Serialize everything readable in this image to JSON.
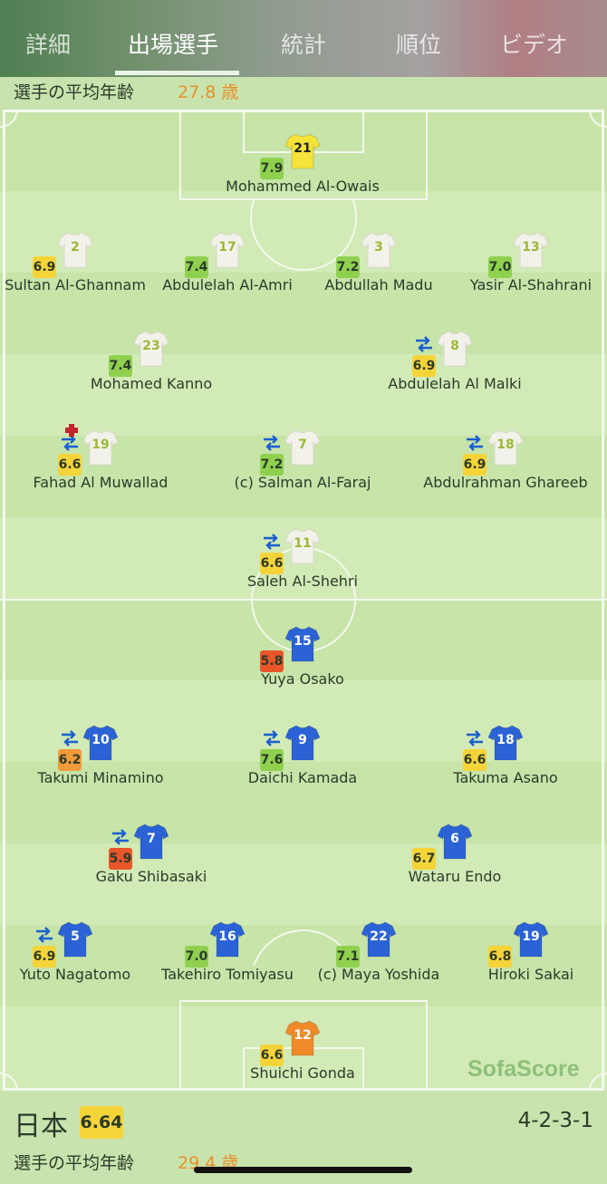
{
  "tabs": [
    "詳細",
    "出場選手",
    "統計",
    "順位",
    "ビデオ"
  ],
  "active_tab": "出場選手",
  "top_team": {
    "avg_age_label": "選手の平均年齢",
    "avg_age_value": "27.8 歳"
  },
  "bottom_team": {
    "name": "日本",
    "rating": "6.64",
    "formation": "4-2-3-1",
    "avg_age_label": "選手の平均年齢",
    "avg_age_value": "29.4 歳"
  },
  "watermark": "SofaScore",
  "colors": {
    "rating_high": "#8fd14f",
    "rating_mid": "#f5d43a",
    "rating_low": "#f09a3a",
    "rating_bad": "#e8562a",
    "home_kit": "#f2f2ea",
    "away_kit": "#2b63d6",
    "keeper_home": "#f5e23a",
    "keeper_away": "#f08a28"
  },
  "players": [
    {
      "name": "Mohammed Al-Owais",
      "number": "21",
      "rating": "7.9",
      "rating_level": "high",
      "kit": "keeper_home",
      "sub": false,
      "card": false
    },
    {
      "name": "Sultan Al-Ghannam",
      "number": "2",
      "rating": "6.9",
      "rating_level": "mid",
      "kit": "home",
      "sub": false,
      "card": false
    },
    {
      "name": "Abdulelah Al-Amri",
      "number": "17",
      "rating": "7.4",
      "rating_level": "high",
      "kit": "home",
      "sub": false,
      "card": false
    },
    {
      "name": "Abdullah Madu",
      "number": "3",
      "rating": "7.2",
      "rating_level": "high",
      "kit": "home",
      "sub": false,
      "card": false
    },
    {
      "name": "Yasir Al-Shahrani",
      "number": "13",
      "rating": "7.0",
      "rating_level": "high",
      "kit": "home",
      "sub": false,
      "card": false
    },
    {
      "name": "Mohamed Kanno",
      "number": "23",
      "rating": "7.4",
      "rating_level": "high",
      "kit": "home",
      "sub": false,
      "card": false
    },
    {
      "name": "Abdulelah Al Malki",
      "number": "8",
      "rating": "6.9",
      "rating_level": "mid",
      "kit": "home",
      "sub": true,
      "card": false
    },
    {
      "name": "Fahad Al Muwallad",
      "number": "19",
      "rating": "6.6",
      "rating_level": "mid",
      "kit": "home",
      "sub": true,
      "card": true
    },
    {
      "name": "(c) Salman Al-Faraj",
      "number": "7",
      "rating": "7.2",
      "rating_level": "high",
      "kit": "home",
      "sub": true,
      "card": false
    },
    {
      "name": "Abdulrahman Ghareeb",
      "number": "18",
      "rating": "6.9",
      "rating_level": "mid",
      "kit": "home",
      "sub": true,
      "card": false
    },
    {
      "name": "Saleh Al-Shehri",
      "number": "11",
      "rating": "6.6",
      "rating_level": "mid",
      "kit": "home",
      "sub": true,
      "card": false
    },
    {
      "name": "Yuya Osako",
      "number": "15",
      "rating": "5.8",
      "rating_level": "bad",
      "kit": "away",
      "sub": false,
      "card": false
    },
    {
      "name": "Takumi Minamino",
      "number": "10",
      "rating": "6.2",
      "rating_level": "low",
      "kit": "away",
      "sub": true,
      "card": false
    },
    {
      "name": "Daichi Kamada",
      "number": "9",
      "rating": "7.6",
      "rating_level": "high",
      "kit": "away",
      "sub": true,
      "card": false
    },
    {
      "name": "Takuma Asano",
      "number": "18",
      "rating": "6.6",
      "rating_level": "mid",
      "kit": "away",
      "sub": true,
      "card": false
    },
    {
      "name": "Gaku Shibasaki",
      "number": "7",
      "rating": "5.9",
      "rating_level": "bad",
      "kit": "away",
      "sub": true,
      "card": false
    },
    {
      "name": "Wataru Endo",
      "number": "6",
      "rating": "6.7",
      "rating_level": "mid",
      "kit": "away",
      "sub": false,
      "card": false
    },
    {
      "name": "Yuto Nagatomo",
      "number": "5",
      "rating": "6.9",
      "rating_level": "mid",
      "kit": "away",
      "sub": true,
      "card": false
    },
    {
      "name": "Takehiro Tomiyasu",
      "number": "16",
      "rating": "7.0",
      "rating_level": "high",
      "kit": "away",
      "sub": false,
      "card": false
    },
    {
      "name": "(c) Maya Yoshida",
      "number": "22",
      "rating": "7.1",
      "rating_level": "high",
      "kit": "away",
      "sub": false,
      "card": false
    },
    {
      "name": "Hiroki Sakai",
      "number": "19",
      "rating": "6.8",
      "rating_level": "mid",
      "kit": "away",
      "sub": false,
      "card": false
    },
    {
      "name": "Shuichi Gonda",
      "number": "12",
      "rating": "6.6",
      "rating_level": "mid",
      "kit": "keeper_away",
      "sub": false,
      "card": false
    }
  ]
}
